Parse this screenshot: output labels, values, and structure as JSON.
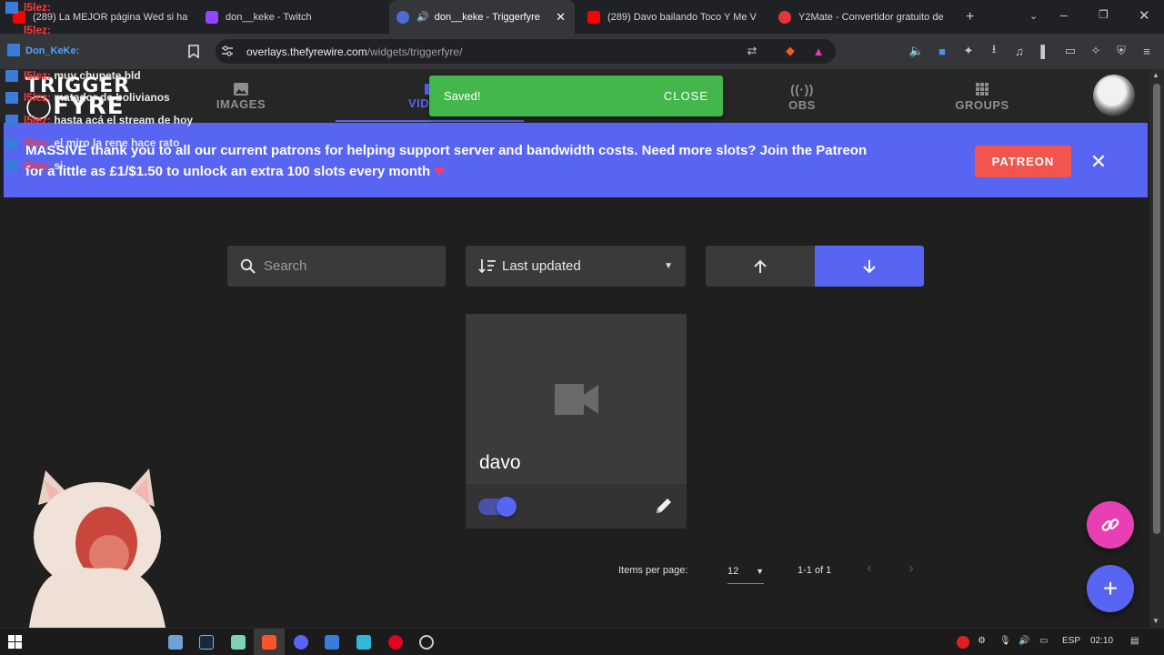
{
  "browser": {
    "tabs": [
      {
        "title": "(289) La MEJOR página Wed si ha",
        "favicon_color": "#ff0000"
      },
      {
        "title": "don__keke - Twitch",
        "favicon_color": "#9146ff"
      },
      {
        "title": "don__keke - Triggerfyre",
        "favicon_color": "#4d6bd8",
        "active": true,
        "audio_icon": "speaker-icon"
      },
      {
        "title": "(289) Davo bailando Toco Y Me V",
        "favicon_color": "#ff0000"
      },
      {
        "title": "Y2Mate - Convertidor gratuito de",
        "favicon_color": "#e5343a"
      }
    ],
    "url_host": "overlays.thefyrewire.com",
    "url_path": "/widgets/triggerfyre/"
  },
  "app": {
    "logo_line1": "TRIGGER",
    "logo_line2": "FYRE",
    "nav": [
      {
        "label": "IMAGES",
        "icon": "image-icon"
      },
      {
        "label": "VIDEOS",
        "icon": "video-icon",
        "active": true
      },
      {
        "label": "OBS",
        "icon": "broadcast-icon"
      },
      {
        "label": "GROUPS",
        "icon": "grid-icon"
      }
    ],
    "accent": "#5865f2"
  },
  "toast": {
    "message": "Saved!",
    "action": "CLOSE",
    "color": "#43b74c"
  },
  "banner": {
    "text_line1": "MASSIVE thank you to all our current patrons for helping support server and bandwidth costs. Need more slots? Join the Patreon",
    "text_line2": "for a little as £1/$1.50 to unlock an extra 100 slots every month",
    "button": "PATREON",
    "close_icon": "close-icon"
  },
  "controls": {
    "search_placeholder": "Search",
    "sort_label": "Last updated"
  },
  "items": [
    {
      "title": "davo",
      "enabled": true,
      "thumb_icon": "videocam-icon"
    }
  ],
  "pagination": {
    "items_per_page_label": "Items per page:",
    "items_per_page": "12",
    "range": "1-1 of 1"
  },
  "overlay_chat": [
    {
      "user": "l5lez:",
      "message": ""
    },
    {
      "user": "l5lez:",
      "message": "muy chupete bld"
    },
    {
      "user": "l5lez:",
      "message": "matador de bolivianos"
    },
    {
      "user": "l5lez:",
      "message": "hasta acá el stream de hoy"
    },
    {
      "user": "l5lez:",
      "message": "el miro la rene hace rato"
    },
    {
      "user": "l5lez:",
      "message": "si"
    }
  ],
  "overlay_channel": "Don_KeKe:",
  "taskbar": {
    "language": "ESP",
    "time": "02:10"
  }
}
